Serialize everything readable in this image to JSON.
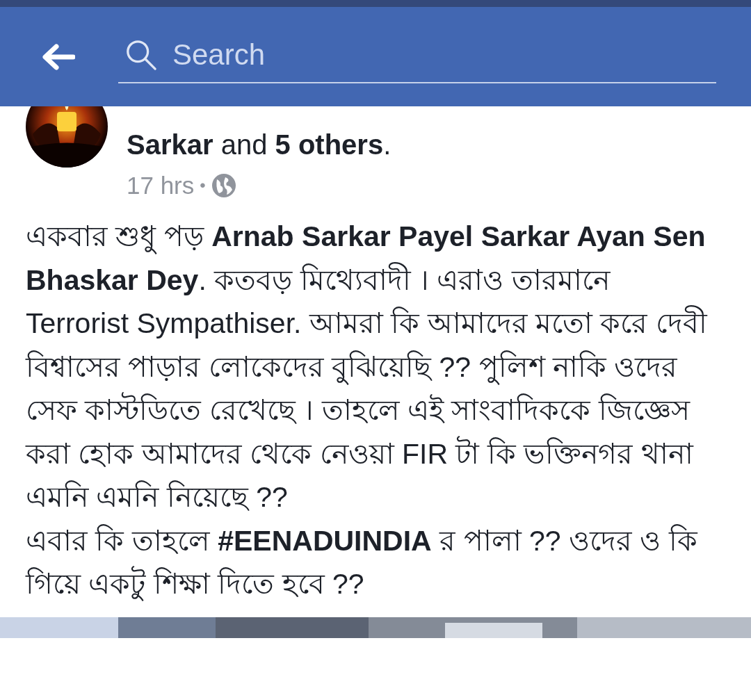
{
  "header": {
    "search": {
      "placeholder": "Search"
    }
  },
  "post": {
    "author_line": "**Sarkar** and **5 others**.",
    "time": "17 hrs",
    "audience_separator": "•",
    "paragraphs": [
      "একবার শুধু পড় **Arnab Sarkar Payel Sarkar Ayan Sen Bhaskar Dey**. কতবড় মিথ্যেবাদী । এরাও তারমানে Terrorist Sympathiser. আমরা কি আমাদের মতো করে দেবী বিশ্বাসের পাড়ার লোকেদের বুঝিয়েছি ?? পুলিশ নাকি ওদের সেফ কাস্টডিতে রেখেছে । তাহলে এই সাংবাদিককে জিজ্ঞেস করা হোক আমাদের থেকে নেওয়া FIR টা কি ভক্তিনগর থানা এমনি এমনি নিয়েছে ??",
      "এবার কি তাহলে **#EENADUINDIA** র পালা ??  ওদের ও কি গিয়ে একটু শিক্ষা দিতে হবে ??"
    ]
  }
}
